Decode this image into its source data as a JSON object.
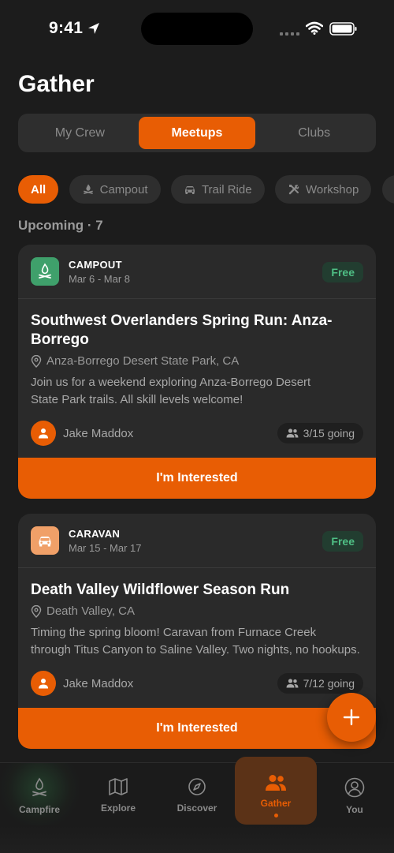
{
  "status_bar": {
    "time": "9:41"
  },
  "page": {
    "title": "Gather"
  },
  "segments": [
    {
      "label": "My Crew",
      "active": false
    },
    {
      "label": "Meetups",
      "active": true
    },
    {
      "label": "Clubs",
      "active": false
    }
  ],
  "filters": [
    {
      "label": "All",
      "icon": "none",
      "active": true
    },
    {
      "label": "Campout",
      "icon": "campfire-icon",
      "active": false
    },
    {
      "label": "Trail Ride",
      "icon": "car-icon",
      "active": false
    },
    {
      "label": "Workshop",
      "icon": "tools-icon",
      "active": false
    }
  ],
  "section": {
    "label": "Upcoming · 7"
  },
  "events": [
    {
      "type": "CAMPOUT",
      "type_icon": "campfire-icon",
      "type_color": "#3fa06b",
      "dates": "Mar 6 - Mar 8",
      "price": "Free",
      "title": "Southwest Overlanders Spring Run: Anza-Borrego",
      "location": "Anza-Borrego Desert State Park, CA",
      "description_line1": "Join us for a weekend exploring Anza-Borrego Desert",
      "description_line2": "State Park trails. All skill levels welcome!",
      "host": "Jake Maddox",
      "going": "3/15 going",
      "cta": "I'm Interested"
    },
    {
      "type": "CARAVAN",
      "type_icon": "car-icon",
      "type_color": "#f0a068",
      "dates": "Mar 15 - Mar 17",
      "price": "Free",
      "title": "Death Valley Wildflower Season Run",
      "location": "Death Valley, CA",
      "description_line1": "Timing the spring bloom! Caravan from Furnace Creek",
      "description_line2": "through Titus Canyon to Saline Valley. Two nights, no hookups.",
      "host": "Jake Maddox",
      "going": "7/12 going",
      "cta": "I'm Interested"
    }
  ],
  "tabbar": {
    "items": [
      {
        "label": "Campfire",
        "icon": "campfire-icon"
      },
      {
        "label": "Explore",
        "icon": "map-icon"
      },
      {
        "label": "Discover",
        "icon": "compass-icon"
      },
      {
        "label": "Gather",
        "icon": "people-icon",
        "active": true
      },
      {
        "label": "You",
        "icon": "person-circle-icon"
      }
    ]
  },
  "colors": {
    "accent": "#e85d04",
    "background": "#1c1c1c",
    "card": "#2a2a2a",
    "free_badge": "#4fbf85"
  }
}
